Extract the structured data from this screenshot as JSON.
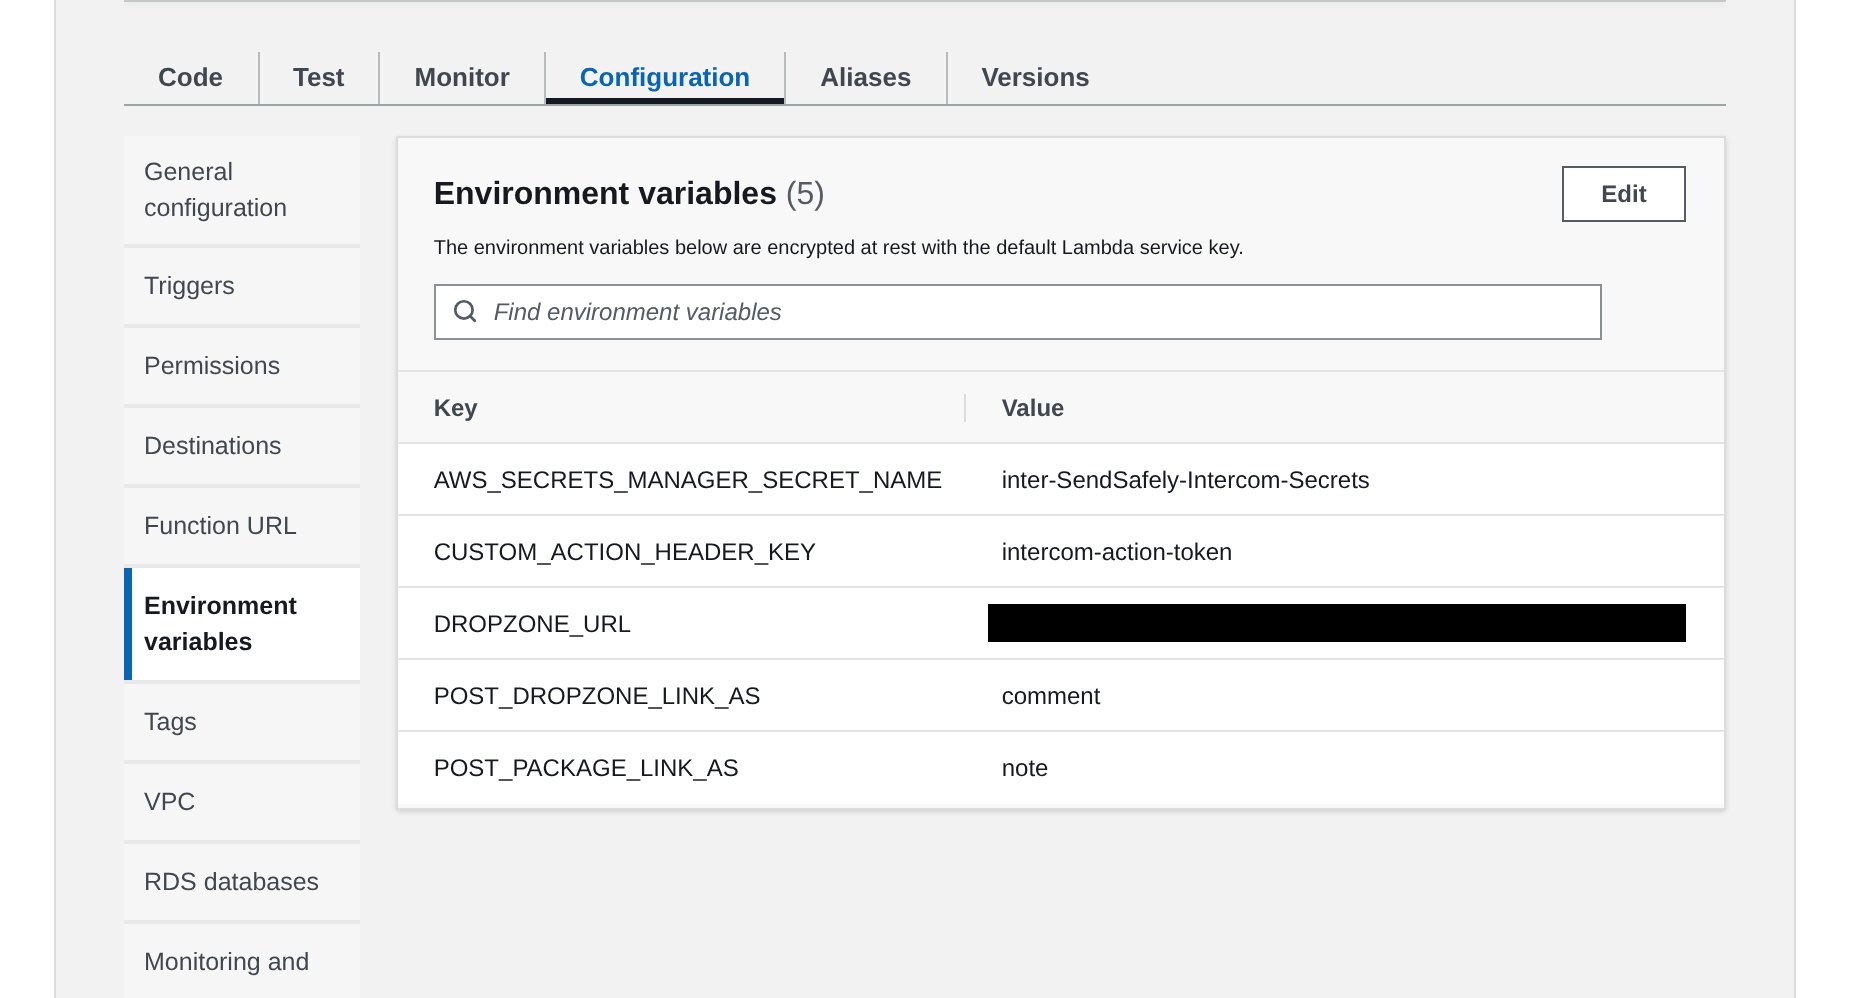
{
  "tabs": [
    {
      "label": "Code",
      "selected": false
    },
    {
      "label": "Test",
      "selected": false
    },
    {
      "label": "Monitor",
      "selected": false
    },
    {
      "label": "Configuration",
      "selected": true
    },
    {
      "label": "Aliases",
      "selected": false
    },
    {
      "label": "Versions",
      "selected": false
    }
  ],
  "sidebar": {
    "items": [
      {
        "label": "General configuration",
        "selected": false
      },
      {
        "label": "Triggers",
        "selected": false
      },
      {
        "label": "Permissions",
        "selected": false
      },
      {
        "label": "Destinations",
        "selected": false
      },
      {
        "label": "Function URL",
        "selected": false
      },
      {
        "label": "Environment variables",
        "selected": true
      },
      {
        "label": "Tags",
        "selected": false
      },
      {
        "label": "VPC",
        "selected": false
      },
      {
        "label": "RDS databases",
        "selected": false
      },
      {
        "label": "Monitoring and",
        "selected": false
      }
    ]
  },
  "panel": {
    "title": "Environment variables",
    "count": "(5)",
    "description": "The environment variables below are encrypted at rest with the default Lambda service key.",
    "edit_button": "Edit",
    "search": {
      "placeholder": "Find environment variables"
    },
    "table": {
      "columns": [
        "Key",
        "Value"
      ],
      "rows": [
        {
          "key": "AWS_SECRETS_MANAGER_SECRET_NAME",
          "value": "inter-SendSafely-Intercom-Secrets",
          "redacted": false
        },
        {
          "key": "CUSTOM_ACTION_HEADER_KEY",
          "value": "intercom-action-token",
          "redacted": false
        },
        {
          "key": "DROPZONE_URL",
          "redacted": true
        },
        {
          "key": "POST_DROPZONE_LINK_AS",
          "value": "comment",
          "redacted": false
        },
        {
          "key": "POST_PACKAGE_LINK_AS",
          "value": "note",
          "redacted": false
        }
      ]
    }
  }
}
